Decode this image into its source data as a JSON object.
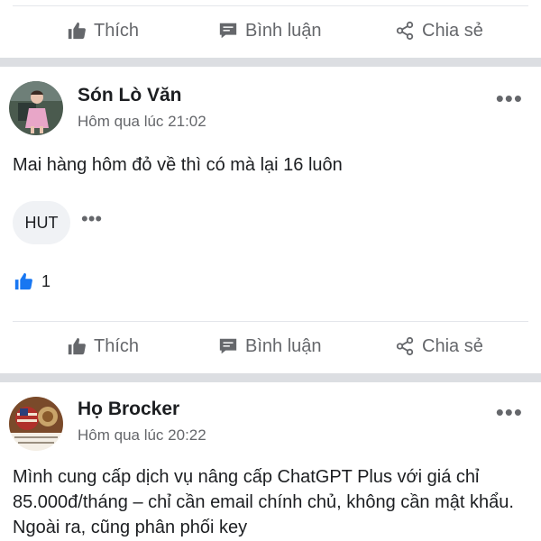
{
  "actions": {
    "like": "Thích",
    "comment": "Bình luận",
    "share": "Chia sẻ"
  },
  "posts": [
    {
      "author": "Són Lò Văn",
      "time": "Hôm qua lúc 21:02",
      "more": "•••",
      "text": "Mai hàng hôm đỏ về thì có mà lại 16 luôn",
      "chip": "HUT",
      "chip_more": "•••",
      "like_count": "1"
    },
    {
      "author": "Họ Brocker",
      "time": "Hôm qua lúc 20:22",
      "more": "•••",
      "text": "Mình cung cấp dịch vụ nâng cấp ChatGPT Plus với giá chỉ 85.000đ/tháng – chỉ cần email chính chủ, không cần mật khẩu. Ngoài ra, cũng phân phối key"
    }
  ],
  "colors": {
    "icon": "#65676b",
    "like_blue": "#1877f2",
    "separator": "#dcdee2"
  }
}
